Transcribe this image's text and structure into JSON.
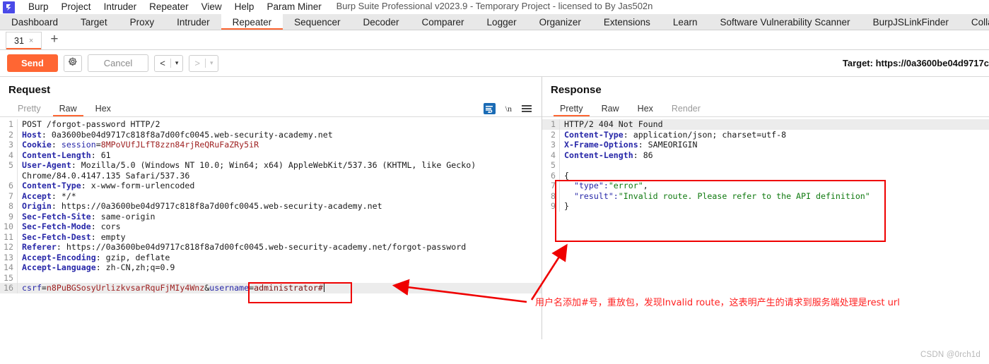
{
  "window": {
    "title": "Burp Suite Professional v2023.9 - Temporary Project - licensed to By Jas502n",
    "logo": "burp-logo"
  },
  "menubar": {
    "items": [
      "Burp",
      "Project",
      "Intruder",
      "Repeater",
      "View",
      "Help",
      "Param Miner"
    ]
  },
  "maintabs": {
    "items": [
      "Dashboard",
      "Target",
      "Proxy",
      "Intruder",
      "Repeater",
      "Sequencer",
      "Decoder",
      "Comparer",
      "Logger",
      "Organizer",
      "Extensions",
      "Learn",
      "Software Vulnerability Scanner",
      "BurpJSLinkFinder",
      "Collaborator"
    ],
    "active": "Repeater"
  },
  "repeater_tabs": {
    "tabs": [
      {
        "label": "31",
        "close": "×"
      }
    ],
    "add_label": "+"
  },
  "actionbar": {
    "send_label": "Send",
    "settings_icon": "gear-icon",
    "cancel_label": "Cancel",
    "prev_arrow": "<",
    "prev_caret": "▾",
    "next_arrow": ">",
    "next_caret": "▾",
    "target_label": "Target: https://0a3600be04d9717c"
  },
  "request": {
    "title": "Request",
    "tabs": [
      {
        "label": "Pretty",
        "state": "inactive"
      },
      {
        "label": "Raw",
        "state": "active"
      },
      {
        "label": "Hex",
        "state": "normal"
      }
    ],
    "tools": [
      "word-wrap-icon",
      "\\n",
      "menu-icon"
    ],
    "lines": [
      {
        "n": "1",
        "segs": [
          {
            "t": "POST /forgot-password HTTP/2",
            "c": "k-plain"
          }
        ]
      },
      {
        "n": "2",
        "segs": [
          {
            "t": "Host",
            "c": "k-hdr"
          },
          {
            "t": ": 0a3600be04d9717c818f8a7d00fc0045.web-security-academy.net",
            "c": "k-plain"
          }
        ]
      },
      {
        "n": "3",
        "segs": [
          {
            "t": "Cookie",
            "c": "k-hdr"
          },
          {
            "t": ": ",
            "c": "k-plain"
          },
          {
            "t": "session",
            "c": "k-blue"
          },
          {
            "t": "=",
            "c": "k-plain"
          },
          {
            "t": "8MPoVUfJLfT8zzn84rjReQRuFaZRy5iR",
            "c": "k-red"
          }
        ]
      },
      {
        "n": "4",
        "segs": [
          {
            "t": "Content-Length",
            "c": "k-hdr"
          },
          {
            "t": ": 61",
            "c": "k-plain"
          }
        ]
      },
      {
        "n": "5",
        "segs": [
          {
            "t": "User-Agent",
            "c": "k-hdr"
          },
          {
            "t": ": Mozilla/5.0 (Windows NT 10.0; Win64; x64) AppleWebKit/537.36 (KHTML, like Gecko)",
            "c": "k-plain"
          }
        ]
      },
      {
        "n": "",
        "segs": [
          {
            "t": "Chrome/84.0.4147.135 Safari/537.36",
            "c": "k-plain"
          }
        ]
      },
      {
        "n": "6",
        "segs": [
          {
            "t": "Content-Type",
            "c": "k-hdr"
          },
          {
            "t": ": x-www-form-urlencoded",
            "c": "k-plain"
          }
        ]
      },
      {
        "n": "7",
        "segs": [
          {
            "t": "Accept",
            "c": "k-hdr"
          },
          {
            "t": ": */*",
            "c": "k-plain"
          }
        ]
      },
      {
        "n": "8",
        "segs": [
          {
            "t": "Origin",
            "c": "k-hdr"
          },
          {
            "t": ": https://0a3600be04d9717c818f8a7d00fc0045.web-security-academy.net",
            "c": "k-plain"
          }
        ]
      },
      {
        "n": "9",
        "segs": [
          {
            "t": "Sec-Fetch-Site",
            "c": "k-hdr"
          },
          {
            "t": ": same-origin",
            "c": "k-plain"
          }
        ]
      },
      {
        "n": "10",
        "segs": [
          {
            "t": "Sec-Fetch-Mode",
            "c": "k-hdr"
          },
          {
            "t": ": cors",
            "c": "k-plain"
          }
        ]
      },
      {
        "n": "11",
        "segs": [
          {
            "t": "Sec-Fetch-Dest",
            "c": "k-hdr"
          },
          {
            "t": ": empty",
            "c": "k-plain"
          }
        ]
      },
      {
        "n": "12",
        "segs": [
          {
            "t": "Referer",
            "c": "k-hdr"
          },
          {
            "t": ": https://0a3600be04d9717c818f8a7d00fc0045.web-security-academy.net/forgot-password",
            "c": "k-plain"
          }
        ]
      },
      {
        "n": "13",
        "segs": [
          {
            "t": "Accept-Encoding",
            "c": "k-hdr"
          },
          {
            "t": ": gzip, deflate",
            "c": "k-plain"
          }
        ]
      },
      {
        "n": "14",
        "segs": [
          {
            "t": "Accept-Language",
            "c": "k-hdr"
          },
          {
            "t": ": zh-CN,zh;q=0.9",
            "c": "k-plain"
          }
        ]
      },
      {
        "n": "15",
        "segs": [
          {
            "t": "",
            "c": "k-plain"
          }
        ]
      },
      {
        "n": "16",
        "highlight": true,
        "segs": [
          {
            "t": "csrf",
            "c": "k-blue"
          },
          {
            "t": "=",
            "c": "k-plain"
          },
          {
            "t": "n8PuBGSosyUrlizkvsarRquFjMIy4Wnz",
            "c": "k-red"
          },
          {
            "t": "&",
            "c": "k-plain"
          },
          {
            "t": "username",
            "c": "k-blue"
          },
          {
            "t": "=",
            "c": "k-plain"
          },
          {
            "t": "administrator#",
            "c": "k-dkred"
          }
        ],
        "caret": true
      }
    ]
  },
  "response": {
    "title": "Response",
    "tabs": [
      {
        "label": "Pretty",
        "state": "active"
      },
      {
        "label": "Raw",
        "state": "normal"
      },
      {
        "label": "Hex",
        "state": "normal"
      },
      {
        "label": "Render",
        "state": "inactive"
      }
    ],
    "lines": [
      {
        "n": "1",
        "highlight": true,
        "segs": [
          {
            "t": "HTTP/2 404 Not Found",
            "c": "k-plain"
          }
        ]
      },
      {
        "n": "2",
        "segs": [
          {
            "t": "Content-Type",
            "c": "k-hdr"
          },
          {
            "t": ": application/json; charset=utf-8",
            "c": "k-plain"
          }
        ]
      },
      {
        "n": "3",
        "segs": [
          {
            "t": "X-Frame-Options",
            "c": "k-hdr"
          },
          {
            "t": ": SAMEORIGIN",
            "c": "k-plain"
          }
        ]
      },
      {
        "n": "4",
        "segs": [
          {
            "t": "Content-Length",
            "c": "k-hdr"
          },
          {
            "t": ": 86",
            "c": "k-plain"
          }
        ]
      },
      {
        "n": "5",
        "segs": [
          {
            "t": "",
            "c": "k-plain"
          }
        ]
      },
      {
        "n": "6",
        "segs": [
          {
            "t": "{",
            "c": "k-plain"
          }
        ]
      },
      {
        "n": "7",
        "segs": [
          {
            "t": "  \"type\":",
            "c": "k-blue"
          },
          {
            "t": "\"error\"",
            "c": "k-green"
          },
          {
            "t": ",",
            "c": "k-plain"
          }
        ]
      },
      {
        "n": "8",
        "segs": [
          {
            "t": "  \"result\":",
            "c": "k-blue"
          },
          {
            "t": "\"Invalid route. Please refer to the API definition\"",
            "c": "k-green"
          }
        ]
      },
      {
        "n": "9",
        "segs": [
          {
            "t": "}",
            "c": "k-plain"
          }
        ]
      }
    ]
  },
  "annotations": {
    "note_text": "用户名添加#号，重放包，发现Invalid route，这表明产生的请求到服务端处理是rest url",
    "box_color": "#ef0000",
    "arrow_color": "#ef0000"
  },
  "watermark": {
    "text": "CSDN @0rch1d"
  }
}
